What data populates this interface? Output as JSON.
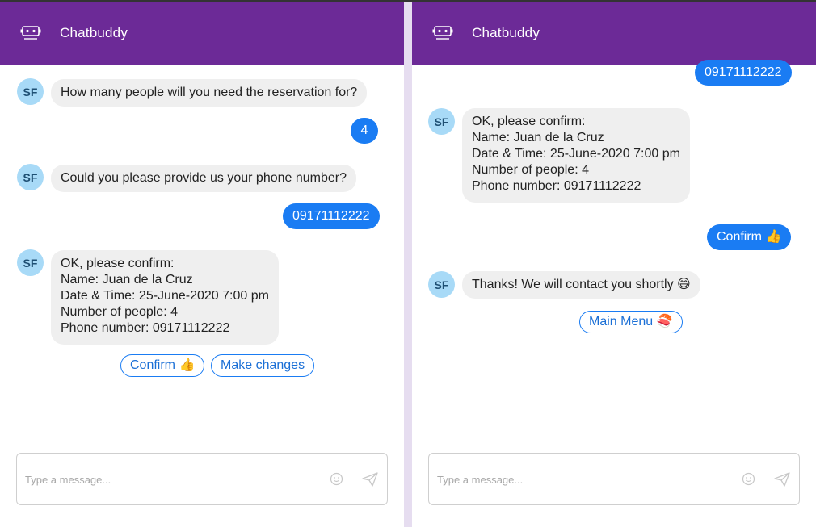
{
  "app": {
    "title": "Chatbuddy",
    "avatar_initials": "SF",
    "composer_placeholder": "Type a message..."
  },
  "left": {
    "messages": [
      {
        "type": "bot",
        "text": "How many people will you need the reservation for?"
      },
      {
        "type": "user",
        "text": "4"
      },
      {
        "type": "bot",
        "text": "Could you please provide us your phone number?"
      },
      {
        "type": "user",
        "text": "09171112222"
      },
      {
        "type": "bot",
        "text": "OK, please confirm:\nName: Juan de la Cruz\nDate & Time: 25-June-2020 7:00 pm\nNumber of people: 4\nPhone number: 09171112222"
      }
    ],
    "quick_replies": [
      "Confirm 👍",
      "Make changes"
    ]
  },
  "right": {
    "messages": [
      {
        "type": "user",
        "text": "09171112222"
      },
      {
        "type": "bot",
        "text": "OK, please confirm:\nName: Juan de la Cruz\nDate & Time: 25-June-2020 7:00 pm\nNumber of people: 4\nPhone number: 09171112222"
      },
      {
        "type": "user",
        "text": "Confirm 👍"
      },
      {
        "type": "bot",
        "text": "Thanks! We will contact you shortly 😄"
      }
    ],
    "quick_replies": [
      "Main Menu 🍣"
    ]
  },
  "colors": {
    "header": "#6c2a97",
    "user_bubble": "#1a7cf3",
    "bot_bubble": "#efefef",
    "avatar": "#a8daf7",
    "divider": "#e6ddf0"
  },
  "icons": {
    "logo": "robot-face-icon",
    "emoji": "smiley-icon",
    "send": "send-icon"
  }
}
